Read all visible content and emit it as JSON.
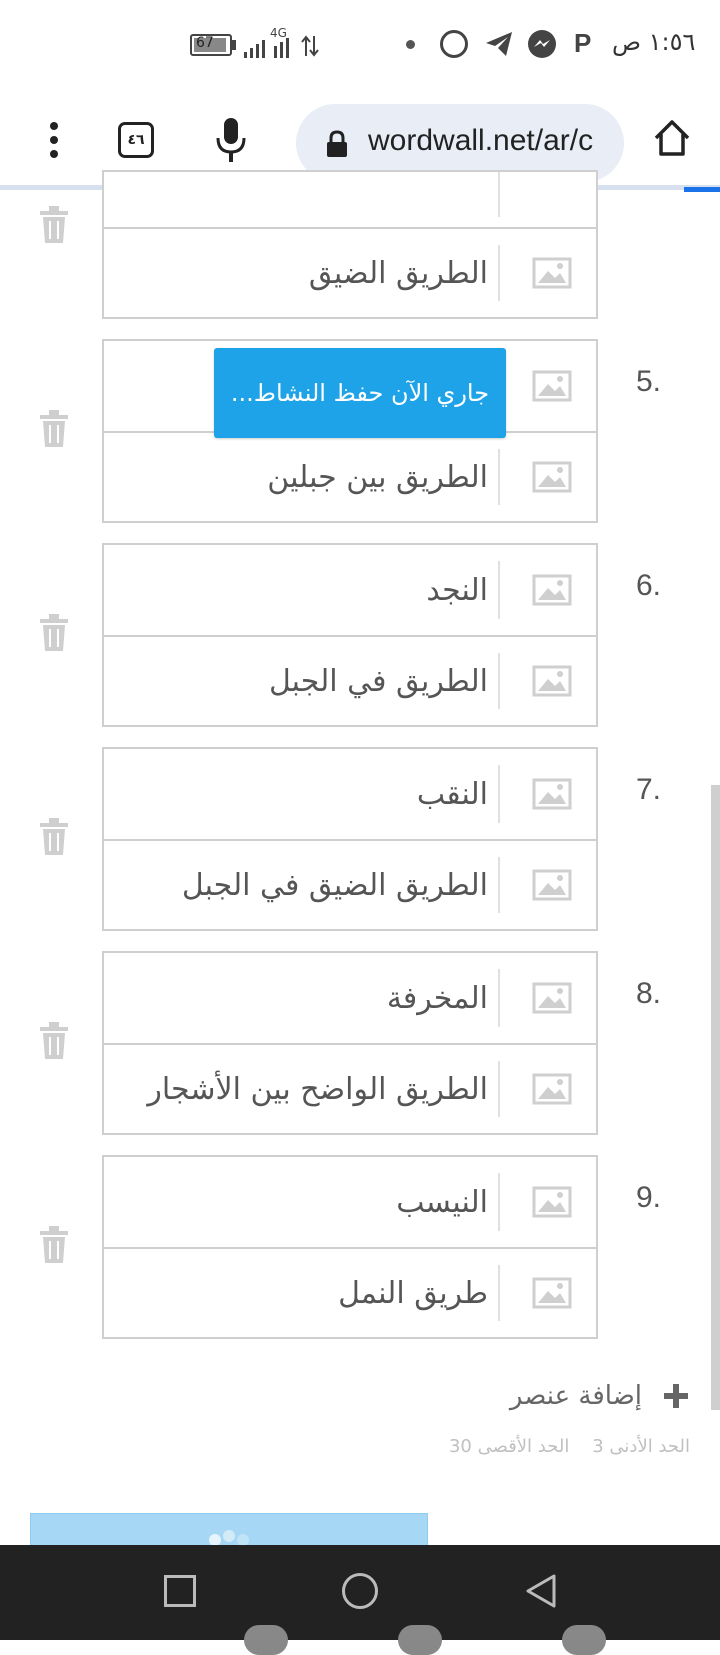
{
  "status_bar": {
    "time": "١:٥٦ ص",
    "battery": "67",
    "network": "4G"
  },
  "browser": {
    "url": "wordwall.net/ar/c",
    "tabs_count": "٤٦"
  },
  "toast": "جاري الآن حفظ النشاط...",
  "items": [
    {
      "number": "",
      "fields": [
        "",
        "الطريق الضيق"
      ]
    },
    {
      "number": "5.",
      "fields": [
        "",
        "الطريق بين جبلين"
      ]
    },
    {
      "number": "6.",
      "fields": [
        "النجد",
        "الطريق في الجبل"
      ]
    },
    {
      "number": "7.",
      "fields": [
        "النقب",
        "الطريق الضيق في الجبل"
      ]
    },
    {
      "number": "8.",
      "fields": [
        "المخرفة",
        "الطريق الواضح بين الأشجار"
      ]
    },
    {
      "number": "9.",
      "fields": [
        "النيسب",
        "طريق النمل"
      ]
    }
  ],
  "add_item_label": "إضافة عنصر",
  "limits": {
    "min_label": "الحد الأدنى",
    "min_value": "3",
    "max_label": "الحد الأقصى",
    "max_value": "30"
  },
  "colors": {
    "accent": "#1a73e8",
    "toast_bg": "#1ea3e8",
    "button_loading": "#a6d8f5"
  }
}
